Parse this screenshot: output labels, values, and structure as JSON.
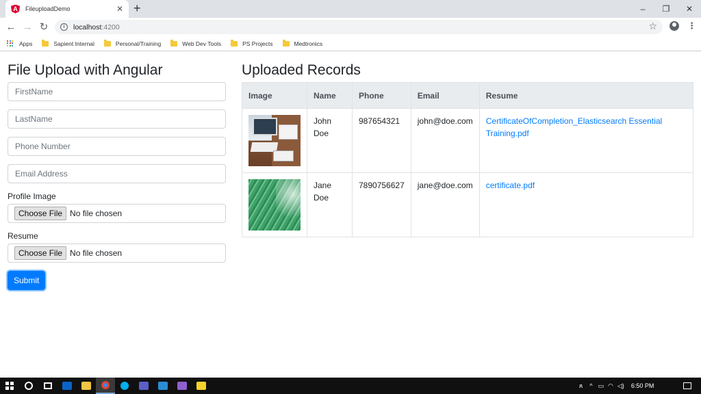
{
  "browser": {
    "tab_title": "FileuploadDemo",
    "tab_favicon_letter": "A",
    "tab_close": "✕",
    "new_tab": "+",
    "window_controls": {
      "minimize": "–",
      "restore": "❐",
      "close": "✕"
    },
    "nav": {
      "back": "←",
      "forward": "→",
      "reload": "↻"
    },
    "url_host": "localhost",
    "url_port": ":4200",
    "bookmarks": [
      "Apps",
      "Sapient Internal",
      "Personal/Training",
      "Web Dev Tools",
      "PS Projects",
      "Medtronics"
    ]
  },
  "form": {
    "title": "File Upload with Angular",
    "first_name_placeholder": "FirstName",
    "last_name_placeholder": "LastName",
    "phone_placeholder": "Phone Number",
    "email_placeholder": "Email Address",
    "profile_image_label": "Profile Image",
    "resume_label": "Resume",
    "choose_file_label": "Choose File",
    "no_file_text": "No file chosen",
    "submit_label": "Submit"
  },
  "records": {
    "title": "Uploaded Records",
    "columns": [
      "Image",
      "Name",
      "Phone",
      "Email",
      "Resume"
    ],
    "rows": [
      {
        "first": "John",
        "last": "Doe",
        "phone": "987654321",
        "email": "john@doe.com",
        "resume": "CertificateOfCompletion_Elasticsearch Essential Training.pdf"
      },
      {
        "first": "Jane",
        "last": "Doe",
        "phone": "7890756627",
        "email": "jane@doe.com",
        "resume": "certificate.pdf"
      }
    ]
  },
  "taskbar": {
    "time": "6:50 PM",
    "icons": [
      "windows-start-icon",
      "cortana-icon",
      "task-view-icon",
      "outlook-icon",
      "file-explorer-icon",
      "chrome-icon",
      "skype-icon",
      "teams-icon",
      "vscode-icon",
      "visual-studio-icon",
      "sticky-notes-icon"
    ]
  },
  "colors": {
    "primary": "#007bff",
    "table_header_bg": "#e9ecef",
    "tabstrip_bg": "#dee1e6",
    "taskbar_bg": "#101010"
  }
}
